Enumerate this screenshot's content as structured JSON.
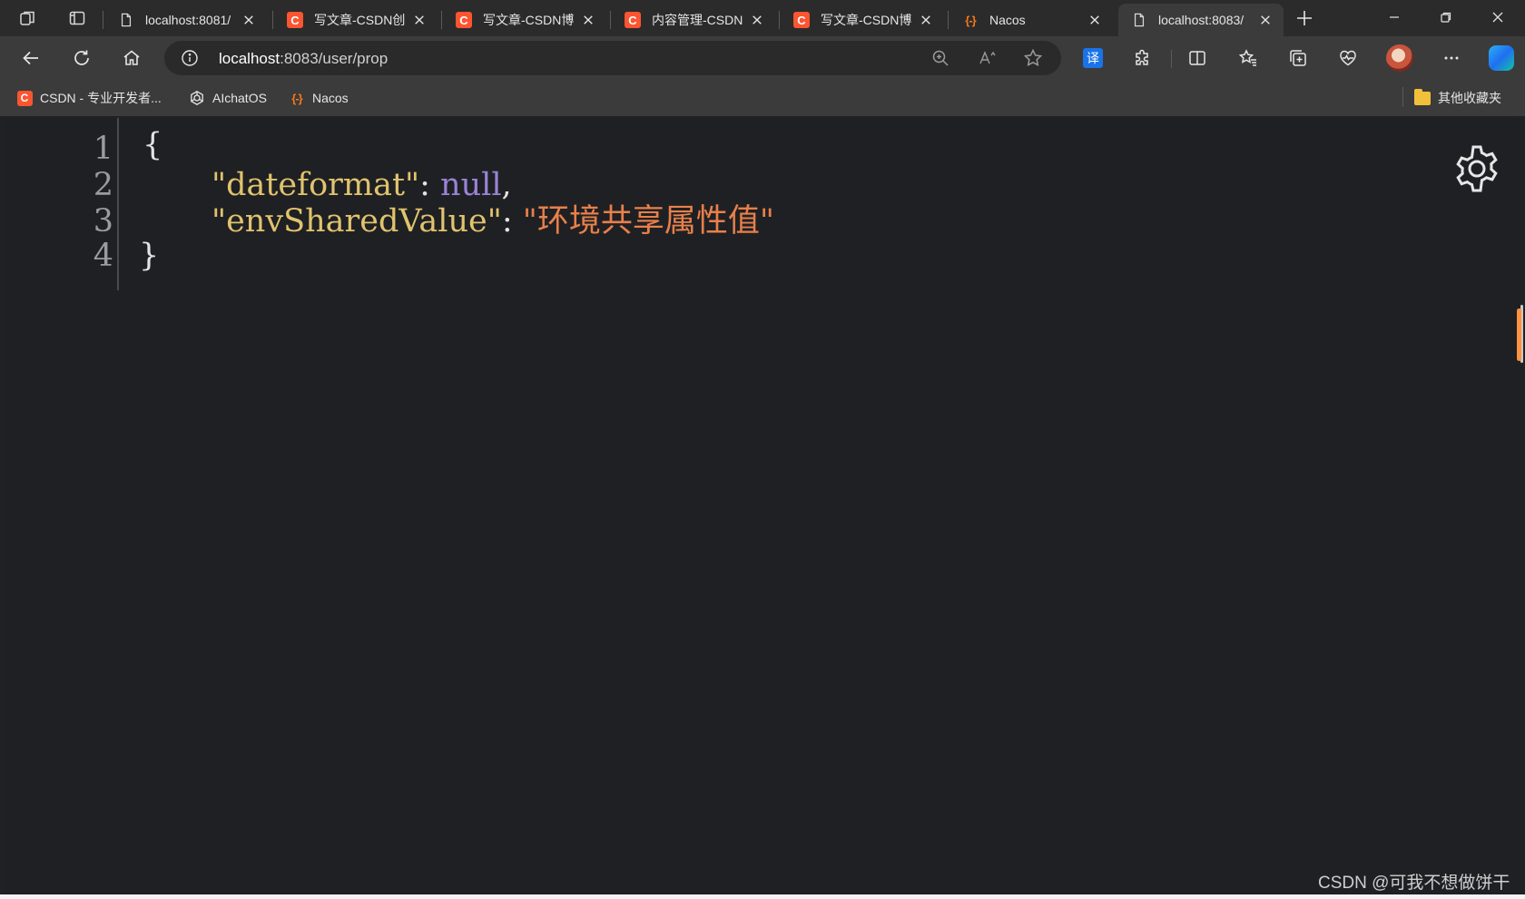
{
  "tabs": [
    {
      "title": "localhost:8081/",
      "favicon": "page-icon"
    },
    {
      "title": "写文章-CSDN创",
      "favicon": "csdn-icon"
    },
    {
      "title": "写文章-CSDN博",
      "favicon": "csdn-icon"
    },
    {
      "title": "内容管理-CSDN",
      "favicon": "csdn-icon"
    },
    {
      "title": "写文章-CSDN博",
      "favicon": "csdn-icon"
    },
    {
      "title": "Nacos",
      "favicon": "nacos-icon"
    },
    {
      "title": "localhost:8083/",
      "favicon": "page-icon",
      "active": true
    }
  ],
  "address": {
    "host": "localhost",
    "rest": ":8083/user/prop"
  },
  "icons": {
    "csdn": "C",
    "nacos": "{-}",
    "translate": "译"
  },
  "bookmarks": [
    {
      "label": "CSDN - 专业开发者...",
      "icon": "csdn-icon"
    },
    {
      "label": "AIchatOS",
      "icon": "openai-icon"
    },
    {
      "label": "Nacos",
      "icon": "nacos-icon"
    },
    {
      "label": "其他收藏夹",
      "icon": "folder-icon"
    }
  ],
  "json_viewer": {
    "line_numbers": [
      "1",
      "2",
      "3",
      "4"
    ],
    "open_brace": "{",
    "close_brace": "}",
    "entries": [
      {
        "key": "\"dateformat\"",
        "sep": ": ",
        "value": "null",
        "value_type": "null",
        "trail": ","
      },
      {
        "key": "\"envSharedValue\"",
        "sep": ": ",
        "value": "\"环境共享属性值\"",
        "value_type": "string",
        "trail": ""
      }
    ]
  },
  "watermark": "CSDN @可我不想做饼干",
  "colors": {
    "key": "#e0c36e",
    "null": "#9a83d6",
    "string": "#e8804b",
    "background": "#1f2023"
  }
}
